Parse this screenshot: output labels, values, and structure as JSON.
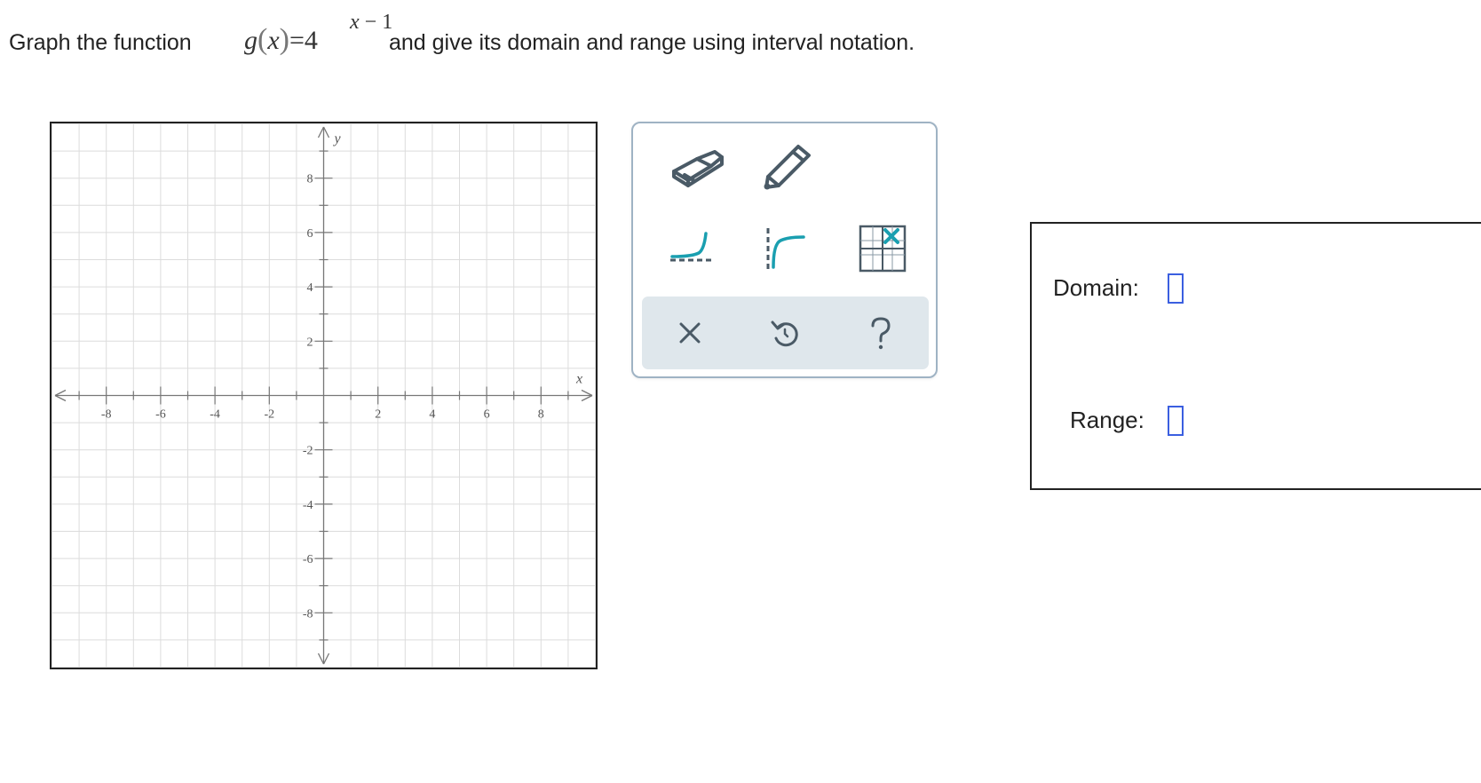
{
  "question": {
    "prefix": "Graph the function",
    "func_name": "g",
    "paren_open": "(",
    "var": "x",
    "paren_close": ")",
    "equals_base": "=4",
    "exponent_var": "x",
    "exponent_rest": "− 1",
    "suffix": "and give its domain and range using interval notation."
  },
  "graph": {
    "x_axis_label": "x",
    "y_axis_label": "y",
    "x_ticks": [
      "-8",
      "-6",
      "-4",
      "-2",
      "2",
      "4",
      "6",
      "8"
    ],
    "y_ticks": [
      "8",
      "6",
      "4",
      "2",
      "-2",
      "-4",
      "-6",
      "-8"
    ]
  },
  "toolbar": {
    "tools": [
      {
        "name": "eraser-tool",
        "icon": "eraser-icon"
      },
      {
        "name": "pencil-tool",
        "icon": "pencil-icon"
      },
      {
        "name": "exponential-tool",
        "icon": "exponential-curve-icon"
      },
      {
        "name": "logarithm-tool",
        "icon": "logarithmic-curve-icon"
      },
      {
        "name": "no-solution-tool",
        "icon": "no-solution-grid-icon"
      }
    ],
    "actions": [
      {
        "name": "clear-button",
        "icon": "close-icon"
      },
      {
        "name": "undo-button",
        "icon": "undo-icon"
      },
      {
        "name": "help-button",
        "icon": "help-icon"
      }
    ],
    "colors": {
      "accent": "#1a9fb0",
      "icon": "#4a5a66",
      "action_bg": "#dfe7ec"
    }
  },
  "answers": {
    "domain_label": "Domain:",
    "range_label": "Range:",
    "input_border_color": "#3b5fe0"
  }
}
